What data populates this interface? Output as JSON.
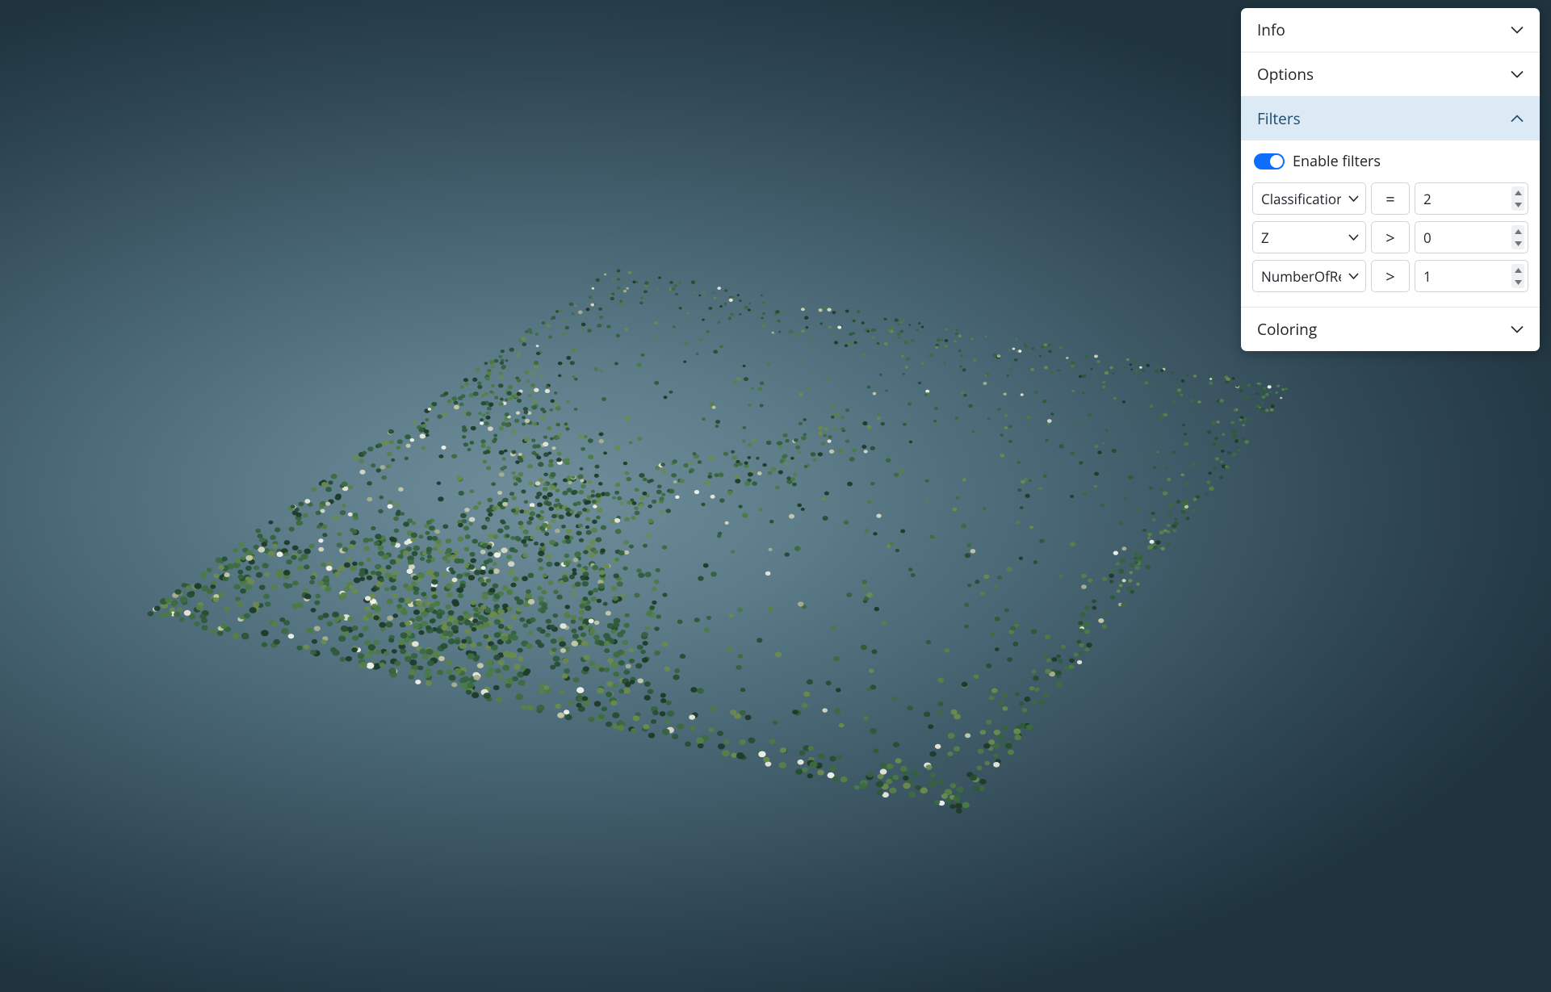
{
  "panel": {
    "sections": {
      "info": {
        "label": "Info",
        "expanded": false
      },
      "options": {
        "label": "Options",
        "expanded": false
      },
      "filters": {
        "label": "Filters",
        "expanded": true
      },
      "coloring": {
        "label": "Coloring",
        "expanded": false
      }
    },
    "filters": {
      "enable_label": "Enable filters",
      "enabled": true,
      "rows": [
        {
          "field": "Classification",
          "operator": "=",
          "value": "2"
        },
        {
          "field": "Z",
          "operator": ">",
          "value": "0"
        },
        {
          "field": "NumberOfReturns",
          "operator": ">",
          "value": "1"
        }
      ]
    }
  }
}
